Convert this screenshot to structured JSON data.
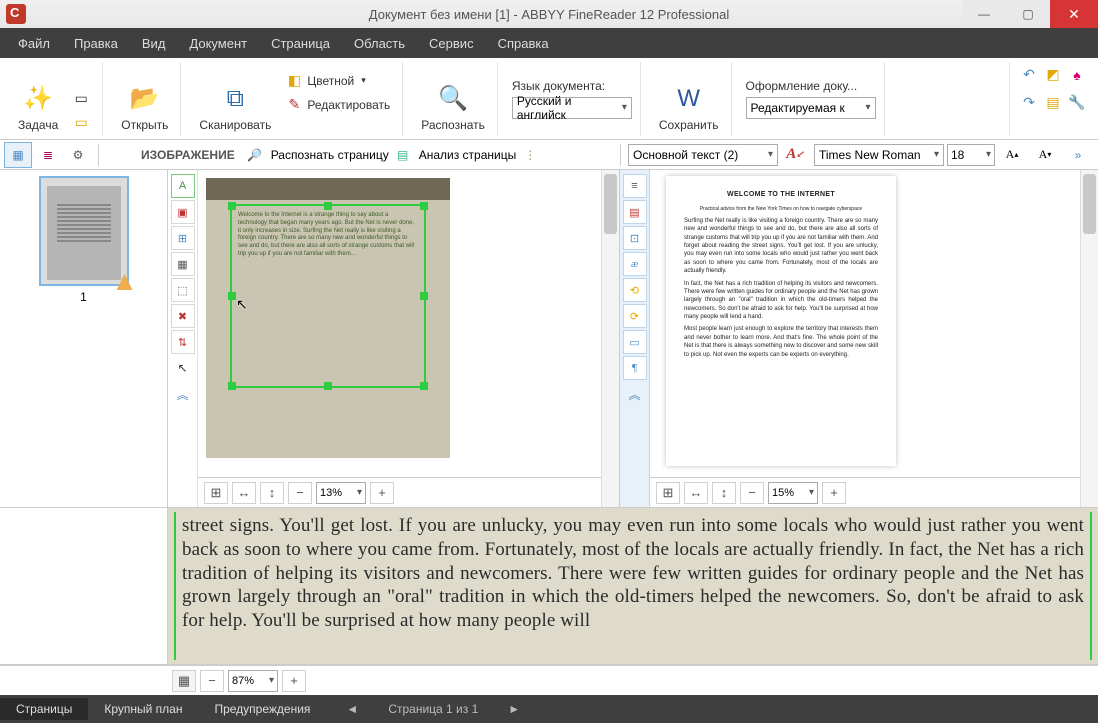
{
  "title": "Документ без имени [1] - ABBYY FineReader 12 Professional",
  "menu": [
    "Файл",
    "Правка",
    "Вид",
    "Документ",
    "Страница",
    "Область",
    "Сервис",
    "Справка"
  ],
  "ribbon": {
    "task": "Задача",
    "open": "Открыть",
    "scan": "Сканировать",
    "color": "Цветной",
    "edit": "Редактировать",
    "recognize": "Распознать",
    "doclang_label": "Язык документа:",
    "doclang_value": "Русский и английск",
    "save": "Сохранить",
    "format_label": "Оформление доку...",
    "format_value": "Редактируемая к"
  },
  "toolbar": {
    "image_label": "ИЗОБРАЖЕНИЕ",
    "recognize_page": "Распознать страницу",
    "analyze_page": "Анализ страницы",
    "body_style": "Основной текст (2)",
    "font": "Times New Roman",
    "size": "18"
  },
  "thumb": {
    "page_number": "1"
  },
  "zoom": {
    "image": "13%",
    "text": "15%",
    "closeup": "87%"
  },
  "closeup_text": "street signs. You'll get lost. If you are unlucky, you may even run into some locals who would just rather you went back as soon to where you came from. Fortunately, most of the locals are actually friendly. In fact, the Net has a rich tradition of helping its visitors and newcomers. There were few written guides for ordinary people and the Net has grown largely through an \"oral\" tradition in which the old-timers helped the newcomers. So, don't be afraid to ask for help. You'll be surprised at how many people will",
  "doc_title": "WELCOME TO THE INTERNET",
  "status": {
    "pages": "Страницы",
    "closeup": "Крупный план",
    "warnings": "Предупреждения",
    "pageinfo": "Страница 1 из 1"
  }
}
